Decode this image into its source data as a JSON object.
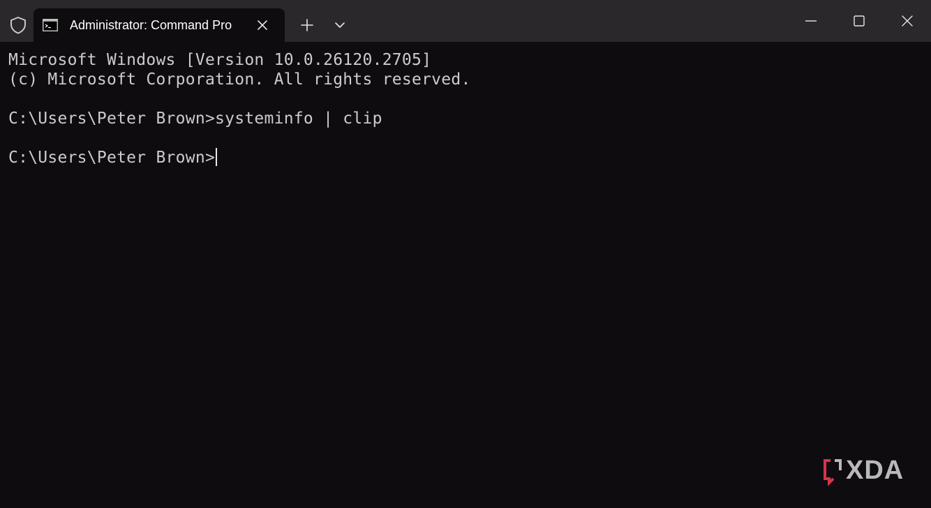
{
  "tab": {
    "title": "Administrator: Command Pro",
    "icon": "command-prompt-icon"
  },
  "titlebar": {
    "shield_icon": "shield-icon",
    "new_tab_icon": "plus-icon",
    "dropdown_icon": "chevron-down-icon",
    "minimize_icon": "minimize-icon",
    "maximize_icon": "maximize-icon",
    "close_icon": "close-icon"
  },
  "terminal": {
    "lines": [
      "Microsoft Windows [Version 10.0.26120.2705]",
      "(c) Microsoft Corporation. All rights reserved.",
      "",
      "C:\\Users\\Peter Brown>systeminfo | clip",
      "",
      "C:\\Users\\Peter Brown>"
    ]
  },
  "watermark": {
    "text": "XDA"
  },
  "colors": {
    "titlebar_bg": "#2a282b",
    "terminal_bg": "#0f0c10",
    "terminal_text": "#cccccc",
    "accent_red": "#d8344b"
  }
}
